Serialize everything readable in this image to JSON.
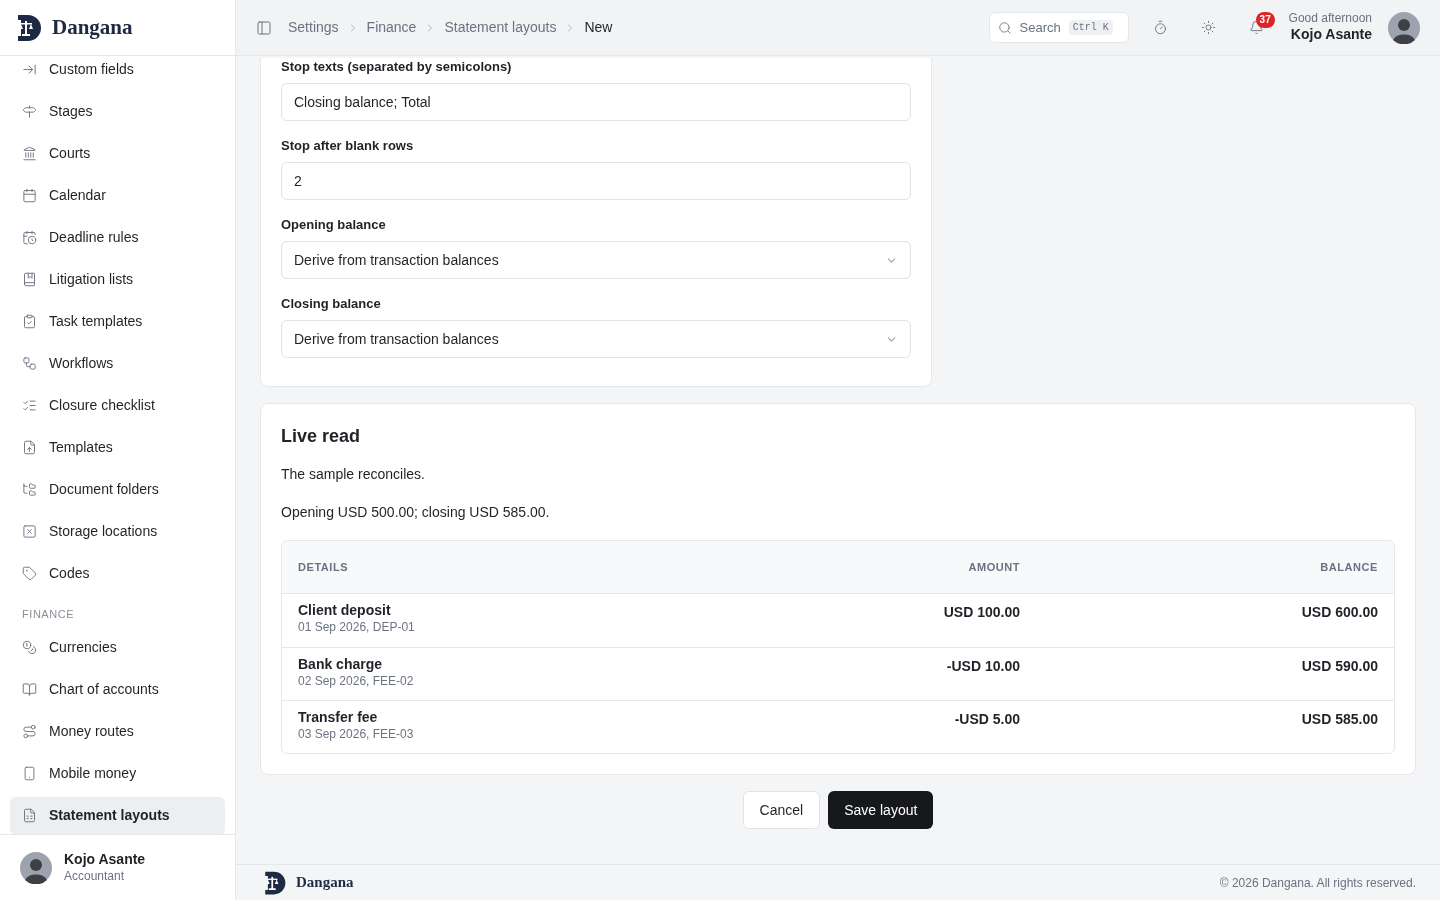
{
  "brand": {
    "name": "Dangana"
  },
  "breadcrumbs": [
    {
      "label": "Settings",
      "selected": false
    },
    {
      "label": "Finance",
      "selected": false
    },
    {
      "label": "Statement layouts",
      "selected": false
    },
    {
      "label": "New",
      "selected": true
    }
  ],
  "search": {
    "placeholder": "Search",
    "shortcut": "Ctrl K"
  },
  "notifications": {
    "count": "37"
  },
  "user": {
    "greeting": "Good afternoon",
    "name": "Kojo Asante"
  },
  "sidebar": {
    "sections": [
      {
        "items": [
          {
            "label": "Custom fields",
            "selected": false
          },
          {
            "label": "Stages",
            "selected": false
          },
          {
            "label": "Courts",
            "selected": false
          },
          {
            "label": "Calendar",
            "selected": false
          },
          {
            "label": "Deadline rules",
            "selected": false
          },
          {
            "label": "Litigation lists",
            "selected": false
          },
          {
            "label": "Task templates",
            "selected": false
          },
          {
            "label": "Workflows",
            "selected": false
          },
          {
            "label": "Closure checklist",
            "selected": false
          },
          {
            "label": "Templates",
            "selected": false
          },
          {
            "label": "Document folders",
            "selected": false
          },
          {
            "label": "Storage locations",
            "selected": false
          },
          {
            "label": "Codes",
            "selected": false
          }
        ]
      },
      {
        "heading": "FINANCE",
        "items": [
          {
            "label": "Currencies",
            "selected": false
          },
          {
            "label": "Chart of accounts",
            "selected": false
          },
          {
            "label": "Money routes",
            "selected": false
          },
          {
            "label": "Mobile money",
            "selected": false
          },
          {
            "label": "Statement layouts",
            "selected": true
          }
        ]
      }
    ],
    "profile": {
      "name": "Kojo Asante",
      "role": "Accountant"
    }
  },
  "form": {
    "fields": [
      {
        "kind": "text",
        "label": "Stop texts (separated by semicolons)",
        "value": "Closing balance; Total"
      },
      {
        "kind": "text",
        "label": "Stop after blank rows",
        "value": "2"
      },
      {
        "kind": "select",
        "label": "Opening balance",
        "value": "Derive from transaction balances"
      },
      {
        "kind": "select",
        "label": "Closing balance",
        "value": "Derive from transaction balances"
      }
    ]
  },
  "live_read": {
    "title": "Live read",
    "messages": [
      "The sample reconciles.",
      "Opening USD 500.00; closing USD 585.00."
    ],
    "table": {
      "columns": [
        "DETAILS",
        "AMOUNT",
        "BALANCE"
      ],
      "rows": [
        {
          "details": "Client deposit",
          "meta": "01 Sep 2026, DEP-01",
          "amount": "USD 100.00",
          "balance": "USD 600.00"
        },
        {
          "details": "Bank charge",
          "meta": "02 Sep 2026, FEE-02",
          "amount": "-USD 10.00",
          "balance": "USD 590.00"
        },
        {
          "details": "Transfer fee",
          "meta": "03 Sep 2026, FEE-03",
          "amount": "-USD 5.00",
          "balance": "USD 585.00"
        }
      ]
    }
  },
  "actions": [
    {
      "label": "Cancel",
      "kind": "secondary"
    },
    {
      "label": "Save layout",
      "kind": "primary"
    }
  ],
  "footer": {
    "brand": "Dangana",
    "copyright": "© 2026 Dangana. All rights reserved."
  }
}
